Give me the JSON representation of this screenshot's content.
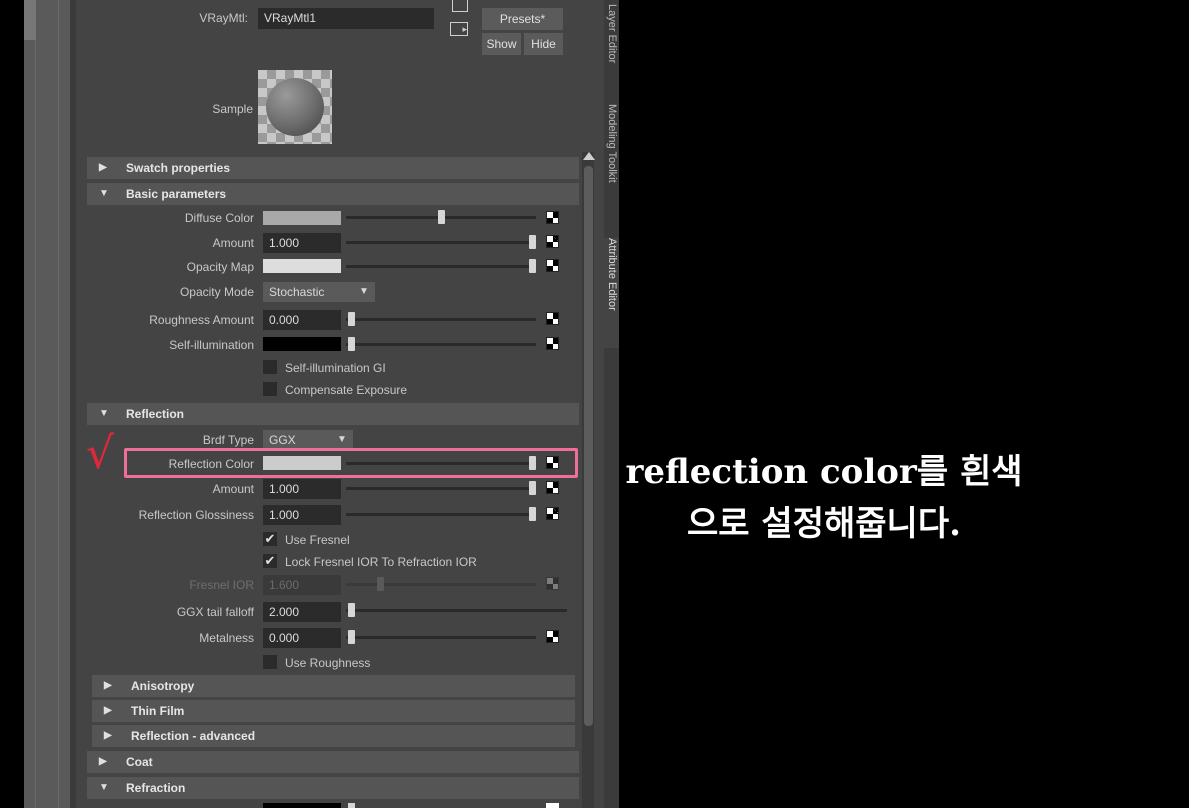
{
  "header": {
    "material_label": "VRayMtl:",
    "material_name": "VRayMtl1",
    "presets_button": "Presets*",
    "show_button": "Show",
    "hide_button": "Hide",
    "sample_label": "Sample"
  },
  "side_tabs": [
    "Layer Editor",
    "Modeling Toolkit",
    "Attribute Editor"
  ],
  "sections": {
    "swatch": "Swatch properties",
    "basic": "Basic parameters",
    "reflection": "Reflection",
    "anisotropy": "Anisotropy",
    "thin_film": "Thin Film",
    "reflection_advanced": "Reflection - advanced",
    "coat": "Coat",
    "refraction": "Refraction"
  },
  "basic": {
    "diffuse_color_label": "Diffuse Color",
    "diffuse_color": "#a9a9a9",
    "diffuse_slider": 0.45,
    "amount_label": "Amount",
    "amount_value": "1.000",
    "opacity_map_label": "Opacity Map",
    "opacity_map_color": "#dddddd",
    "opacity_mode_label": "Opacity Mode",
    "opacity_mode_value": "Stochastic",
    "roughness_label": "Roughness Amount",
    "roughness_value": "0.000",
    "self_illum_label": "Self-illumination",
    "self_illum_color": "#000000",
    "self_illum_gi_label": "Self-illumination GI",
    "compensate_label": "Compensate Exposure"
  },
  "reflection": {
    "brdf_label": "Brdf Type",
    "brdf_value": "GGX",
    "refl_color_label": "Reflection Color",
    "refl_color": "#cccccc",
    "amount_label": "Amount",
    "amount_value": "1.000",
    "glossiness_label": "Reflection Glossiness",
    "glossiness_value": "1.000",
    "use_fresnel_label": "Use Fresnel",
    "lock_fresnel_label": "Lock Fresnel IOR To Refraction IOR",
    "fresnel_ior_label": "Fresnel IOR",
    "fresnel_ior_value": "1.600",
    "ggx_tail_label": "GGX tail falloff",
    "ggx_tail_value": "2.000",
    "metalness_label": "Metalness",
    "metalness_value": "0.000",
    "use_roughness_label": "Use Roughness"
  },
  "annotation": {
    "line1": "reflection color를 흰색",
    "line2": "으로 설정해줍니다.",
    "highlight_color": "#ef6f96",
    "check_color": "#e0283c",
    "check_glyph": "√"
  }
}
